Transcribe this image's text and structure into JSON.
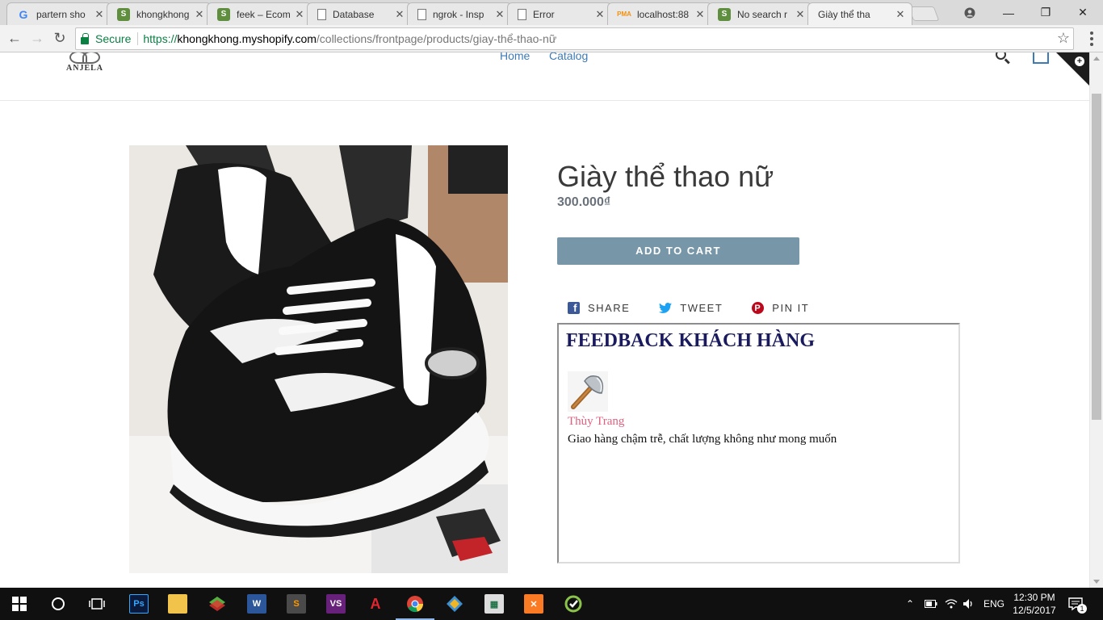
{
  "browser": {
    "tabs": [
      {
        "title": "partern sho",
        "favicon": "google-icon"
      },
      {
        "title": "khongkhong",
        "favicon": "shopify-icon"
      },
      {
        "title": "feek – Ecom",
        "favicon": "shopify-icon"
      },
      {
        "title": "Database",
        "favicon": "document-icon"
      },
      {
        "title": "ngrok - Insp",
        "favicon": "document-icon"
      },
      {
        "title": "Error",
        "favicon": "document-icon"
      },
      {
        "title": "localhost:88",
        "favicon": "phpmyadmin-icon"
      },
      {
        "title": "No search r",
        "favicon": "shopify-icon"
      },
      {
        "title": "Giày thể tha",
        "favicon": "none"
      }
    ],
    "secure_label": "Secure",
    "url": {
      "scheme": "https://",
      "host": "khongkhong.myshopify.com",
      "path": "/collections/frontpage/products/giay-thể-thao-nữ"
    }
  },
  "site": {
    "logo_text": "ANJELA",
    "nav": {
      "home": "Home",
      "catalog": "Catalog"
    }
  },
  "product": {
    "title": "Giày thể thao nữ",
    "price": "300.000₫",
    "add_to_cart": "ADD TO CART",
    "share": {
      "facebook": "SHARE",
      "twitter": "TWEET",
      "pinterest": "PIN IT"
    }
  },
  "feedback": {
    "title": "FEEDBACK KHÁCH HÀNG",
    "reviews": [
      {
        "name": "Thùy Trang",
        "text": "Giao hàng chậm trễ, chất lượng không như mong muốn",
        "avatar": "axe-icon"
      }
    ]
  },
  "taskbar": {
    "language": "ENG",
    "time": "12:30 PM",
    "date": "12/5/2017",
    "notification_count": "1"
  },
  "colors": {
    "accent": "#7796a8",
    "link": "#3d7bb8",
    "reviewer_name": "#e0607e",
    "feedback_title": "#1a1a5e"
  }
}
